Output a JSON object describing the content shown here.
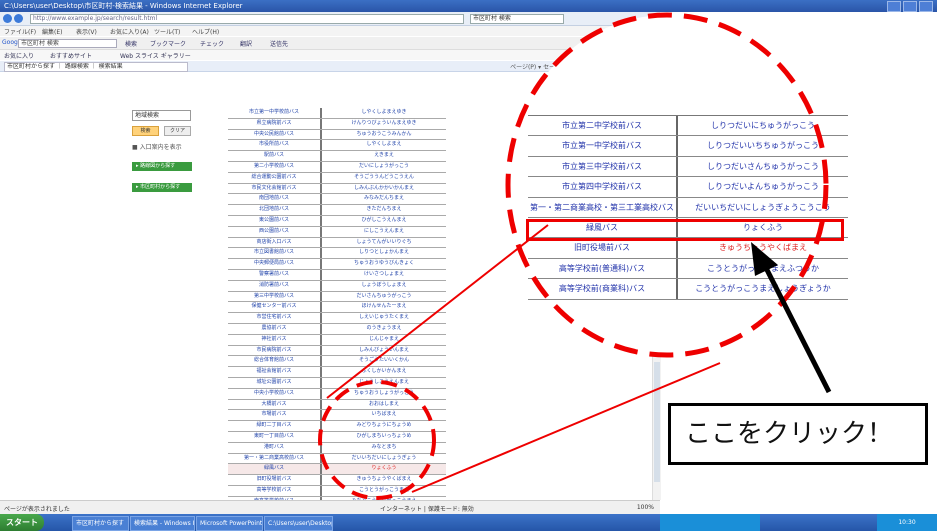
{
  "window": {
    "title": "C:\\Users\\user\\Desktop\\市区町村-検索結果 - Windows Internet Explorer",
    "address": "http://www.example.jp/search/result.html"
  },
  "menu": [
    "ファイル(F)",
    "編集(E)",
    "表示(V)",
    "お気に入り(A)",
    "ツール(T)",
    "ヘルプ(H)"
  ],
  "google": {
    "label": "Google",
    "query": "市区町村 検索",
    "links": [
      "検索",
      "ブックマーク",
      "チェック",
      "翻訳",
      "送信先"
    ]
  },
  "favorites": [
    "お気に入り",
    "おすすめサイト",
    "Web スライス ギャラリー"
  ],
  "tab": {
    "label": "市区町村から探す ｜ 路線検索 ｜ 検索結果"
  },
  "tab_tools": "ページ(P) ▾  セーフティ(S) ▾  ツール(O) ▾",
  "left": {
    "keyword_value": "地域検索",
    "search_button": "検索",
    "clear_button": "クリア",
    "option_label": "■ 入口案内を表示",
    "green_buttons": [
      "▸ 路線図から探す",
      "▸ 市区町村から探す"
    ]
  },
  "grid_rows": [
    {
      "c1": "市立第一中学校前バス",
      "c2": "しやくしよまえゆき"
    },
    {
      "c1": "県立病院前バス",
      "c2": "けんりつびょういんまえゆき"
    },
    {
      "c1": "中央公民館前バス",
      "c2": "ちゅうおうこうみんかん"
    },
    {
      "c1": "市役所前バス",
      "c2": "しやくしよまえ"
    },
    {
      "c1": "駅前バス",
      "c2": "えきまえ"
    },
    {
      "c1": "第二小学校前バス",
      "c2": "だいにしょうがっこう"
    },
    {
      "c1": "総合運動公園前バス",
      "c2": "そうごううんどうこうえん"
    },
    {
      "c1": "市民文化会館前バス",
      "c2": "しみんぶんかかいかんまえ"
    },
    {
      "c1": "南団地前バス",
      "c2": "みなみだんちまえ"
    },
    {
      "c1": "北団地前バス",
      "c2": "きただんちまえ"
    },
    {
      "c1": "東公園前バス",
      "c2": "ひがしこうえんまえ"
    },
    {
      "c1": "西公園前バス",
      "c2": "にしこうえんまえ"
    },
    {
      "c1": "商店街入口バス",
      "c2": "しょうてんがいいりぐち"
    },
    {
      "c1": "市立図書館前バス",
      "c2": "しりつとしょかんまえ"
    },
    {
      "c1": "中央郵便局前バス",
      "c2": "ちゅうおうゆうびんきょく"
    },
    {
      "c1": "警察署前バス",
      "c2": "けいさつしょまえ"
    },
    {
      "c1": "消防署前バス",
      "c2": "しょうぼうしょまえ"
    },
    {
      "c1": "第三中学校前バス",
      "c2": "だいさんちゅうがっこう"
    },
    {
      "c1": "保健センター前バス",
      "c2": "ほけんせんたーまえ"
    },
    {
      "c1": "市営住宅前バス",
      "c2": "しえいじゅうたくまえ"
    },
    {
      "c1": "農協前バス",
      "c2": "のうきょうまえ"
    },
    {
      "c1": "神社前バス",
      "c2": "じんじゃまえ"
    },
    {
      "c1": "市民病院前バス",
      "c2": "しみんびょういんまえ"
    },
    {
      "c1": "総合体育館前バス",
      "c2": "そうごうたいいくかん"
    },
    {
      "c1": "福祉会館前バス",
      "c2": "ふくしかいかんまえ"
    },
    {
      "c1": "城址公園前バス",
      "c2": "じょうしこうえんまえ"
    },
    {
      "c1": "中央小学校前バス",
      "c2": "ちゅうおうしょうがっこう"
    },
    {
      "c1": "大橋前バス",
      "c2": "おおはしまえ"
    },
    {
      "c1": "市場前バス",
      "c2": "いちばまえ"
    },
    {
      "c1": "緑町二丁目バス",
      "c2": "みどりちょうにちょうめ"
    },
    {
      "c1": "東町一丁目前バス",
      "c2": "ひがしまちいっちょうめ"
    },
    {
      "c1": "港町バス",
      "c2": "みなとまち"
    },
    {
      "c1": "第一・第二商業高校前バス",
      "c2": "だいいちだいにしょうぎょう"
    },
    {
      "c1": "緑風バス",
      "c2": "りょくふう"
    },
    {
      "c1": "旧町役場前バス",
      "c2": "きゅうちょうやくばまえ"
    },
    {
      "c1": "高等学校前バス",
      "c2": "こうとうがっこうまえ"
    },
    {
      "c1": "南高等学校前バス",
      "c2": "みなみこうとうがっこうまえ"
    }
  ],
  "zoom_rows": [
    {
      "c1": "市立第二中学校前バス",
      "c2": "しりつだいにちゅうがっこう"
    },
    {
      "c1": "市立第一中学校前バス",
      "c2": "しりつだいいちちゅうがっこう"
    },
    {
      "c1": "市立第三中学校前バス",
      "c2": "しりつだいさんちゅうがっこう"
    },
    {
      "c1": "市立第四中学校前バス",
      "c2": "しりつだいよんちゅうがっこう"
    },
    {
      "c1": "第一・第二商業高校・第三工業高校バス",
      "c2": "だいいちだいにしょうぎょうこうこう"
    },
    {
      "c1": "緑風バス",
      "c2": "りょくふう"
    },
    {
      "c1": "旧町役場前バス",
      "c2": "きゅうちょうやくばまえ"
    },
    {
      "c1": "高等学校前(普通科)バス",
      "c2": "こうとうがっこうまえふつうか"
    },
    {
      "c1": "高等学校前(商業科)バス",
      "c2": "こうとうがっこうまえしょうぎょうか"
    }
  ],
  "callout": "ここをクリック！",
  "status": {
    "text": "ページが表示されました",
    "zone": "インターネット | 保護モード: 無効",
    "zoom": "100%"
  },
  "taskbar": {
    "start": "スタート",
    "tasks": [
      "市区町村から探す",
      "検索結果 - Windows Internet...",
      "Microsoft PowerPoint",
      "C:\\Users\\user\\Desktop"
    ],
    "clock": "10:30"
  },
  "annotation_color": "#e00000"
}
